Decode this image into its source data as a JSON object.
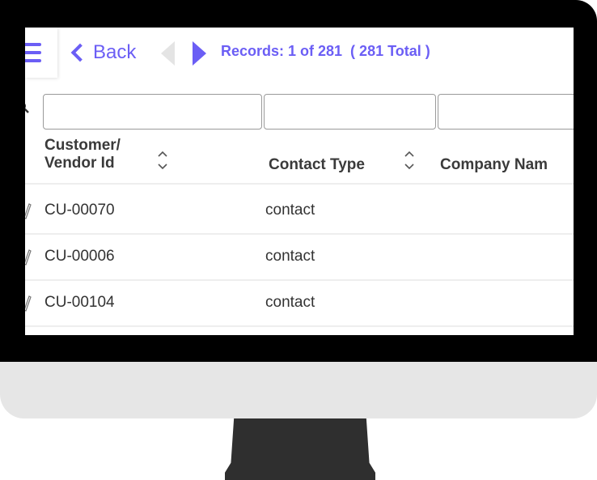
{
  "toolbar": {
    "back_label": "Back",
    "records_text": "Records: 1 of 281  ( 281 Total )"
  },
  "filters": {
    "placeholder": ""
  },
  "table": {
    "columns": [
      "Customer/\nVendor Id",
      "Contact Type",
      "Company Nam"
    ],
    "rows": [
      {
        "vendor_id": "CU-00070",
        "contact_type": "contact",
        "company": ""
      },
      {
        "vendor_id": "CU-00006",
        "contact_type": "contact",
        "company": ""
      },
      {
        "vendor_id": "CU-00104",
        "contact_type": "contact",
        "company": ""
      }
    ]
  },
  "colors": {
    "accent": "#6b5ef5",
    "bezel": "#000000",
    "chin": "#e6e6e6",
    "stand": "#2f2f2f"
  },
  "icons": [
    "menu-icon",
    "chevron-left-icon",
    "prev-arrow-icon",
    "next-arrow-icon",
    "search-icon",
    "sort-icon",
    "edit-icon"
  ]
}
